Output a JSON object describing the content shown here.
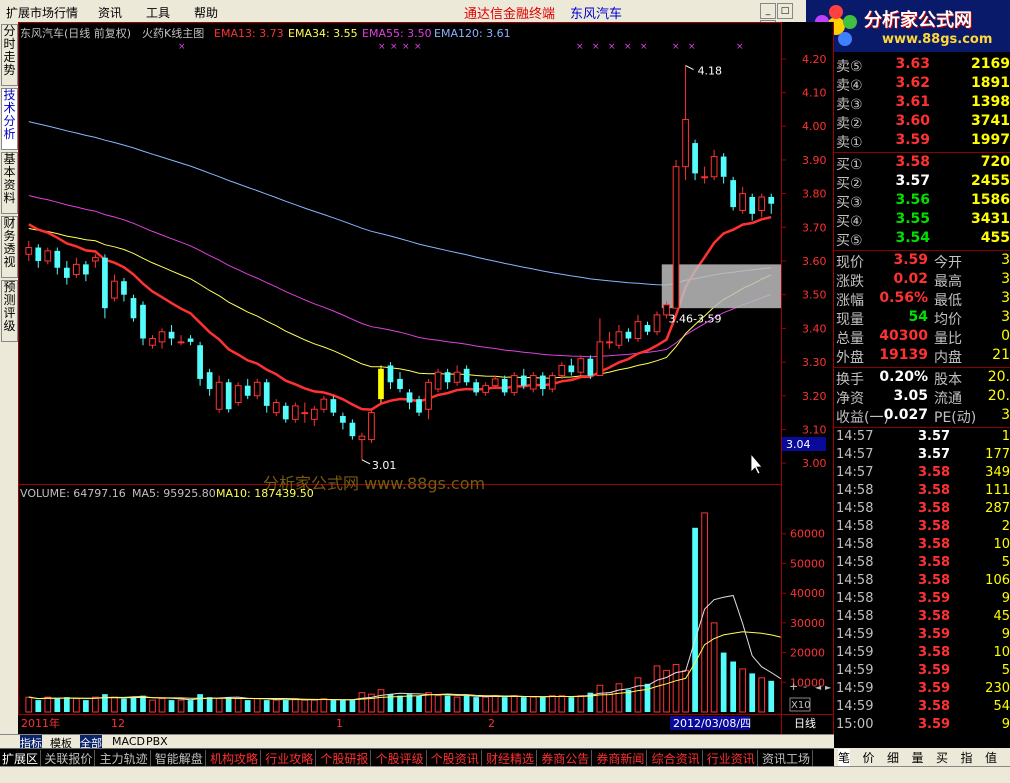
{
  "menubar": {
    "items": [
      "扩展市场行情",
      "资讯",
      "工具",
      "帮助"
    ],
    "ad1": "通达信金融终端",
    "ad2": "东风汽车"
  },
  "logo": {
    "title": "分析家公式网",
    "url": "www.88gs.com"
  },
  "left_tabs": [
    "分时走势",
    "技术分析",
    "基本资料",
    "财务透视",
    "预测评级"
  ],
  "chart_header": {
    "stock": "东风汽车(日线 前复权)",
    "formula": "火药K线主图",
    "ema13": "EMA13: 3.73",
    "ema34": "EMA34: 3.55",
    "ema55": "EMA55: 3.50",
    "ema120": "EMA120: 3.61"
  },
  "colors": {
    "up": "#ff3232",
    "down": "#54fcfc",
    "ema13": "#ff3232",
    "ema34": "#ffff54",
    "ema55": "#e040e0",
    "ema120": "#8ab4ff",
    "highlight": "#ffff00"
  },
  "price_axis": {
    "ticks": [
      "4.20",
      "4.10",
      "4.00",
      "3.90",
      "3.80",
      "3.70",
      "3.60",
      "3.50",
      "3.40",
      "3.30",
      "3.20",
      "3.10",
      "3.00"
    ],
    "min": 2.95,
    "max": 4.25,
    "current_label": "3.04"
  },
  "annotations": {
    "high": "4.18",
    "low": "3.01",
    "range": "3.46-3.59"
  },
  "watermark": "分析家公式网  www.88gs.com",
  "volume_header": {
    "volume": "VOLUME: 64797.16",
    "ma5": "MA5: 95925.80",
    "ma10": "MA10: 187439.50"
  },
  "volume_axis": {
    "ticks": [
      "60000",
      "50000",
      "40000",
      "30000",
      "20000",
      "10000"
    ],
    "max": 70000,
    "unit": "X10"
  },
  "date_axis": {
    "labels": [
      "2011年",
      "12",
      "1",
      "2"
    ],
    "cursor_date": "2012/03/08/四",
    "period": "日线"
  },
  "chart_data": {
    "type": "candlestick",
    "candles": [
      {
        "o": 3.62,
        "c": 3.64,
        "h": 3.66,
        "l": 3.6
      },
      {
        "o": 3.64,
        "c": 3.6,
        "h": 3.65,
        "l": 3.58
      },
      {
        "o": 3.6,
        "c": 3.63,
        "h": 3.64,
        "l": 3.59
      },
      {
        "o": 3.63,
        "c": 3.58,
        "h": 3.64,
        "l": 3.56
      },
      {
        "o": 3.58,
        "c": 3.55,
        "h": 3.6,
        "l": 3.53
      },
      {
        "o": 3.56,
        "c": 3.59,
        "h": 3.61,
        "l": 3.55
      },
      {
        "o": 3.59,
        "c": 3.56,
        "h": 3.6,
        "l": 3.54
      },
      {
        "o": 3.6,
        "c": 3.61,
        "h": 3.62,
        "l": 3.58
      },
      {
        "o": 3.61,
        "c": 3.46,
        "h": 3.62,
        "l": 3.43
      },
      {
        "o": 3.49,
        "c": 3.54,
        "h": 3.56,
        "l": 3.48
      },
      {
        "o": 3.54,
        "c": 3.5,
        "h": 3.55,
        "l": 3.48
      },
      {
        "o": 3.49,
        "c": 3.43,
        "h": 3.5,
        "l": 3.42
      },
      {
        "o": 3.47,
        "c": 3.37,
        "h": 3.48,
        "l": 3.35
      },
      {
        "o": 3.35,
        "c": 3.37,
        "h": 3.38,
        "l": 3.34
      },
      {
        "o": 3.36,
        "c": 3.39,
        "h": 3.4,
        "l": 3.34
      },
      {
        "o": 3.39,
        "c": 3.37,
        "h": 3.41,
        "l": 3.35
      },
      {
        "o": 3.36,
        "c": 3.36,
        "h": 3.38,
        "l": 3.35
      },
      {
        "o": 3.37,
        "c": 3.36,
        "h": 3.38,
        "l": 3.35
      },
      {
        "o": 3.35,
        "c": 3.25,
        "h": 3.36,
        "l": 3.23
      },
      {
        "o": 3.27,
        "c": 3.22,
        "h": 3.28,
        "l": 3.2
      },
      {
        "o": 3.16,
        "c": 3.24,
        "h": 3.26,
        "l": 3.15
      },
      {
        "o": 3.24,
        "c": 3.16,
        "h": 3.25,
        "l": 3.15
      },
      {
        "o": 3.18,
        "c": 3.23,
        "h": 3.24,
        "l": 3.17
      },
      {
        "o": 3.23,
        "c": 3.2,
        "h": 3.25,
        "l": 3.19
      },
      {
        "o": 3.2,
        "c": 3.24,
        "h": 3.25,
        "l": 3.19
      },
      {
        "o": 3.24,
        "c": 3.17,
        "h": 3.25,
        "l": 3.15
      },
      {
        "o": 3.15,
        "c": 3.18,
        "h": 3.19,
        "l": 3.14
      },
      {
        "o": 3.17,
        "c": 3.13,
        "h": 3.18,
        "l": 3.12
      },
      {
        "o": 3.13,
        "c": 3.17,
        "h": 3.18,
        "l": 3.12
      },
      {
        "o": 3.15,
        "c": 3.15,
        "h": 3.18,
        "l": 3.12
      },
      {
        "o": 3.13,
        "c": 3.16,
        "h": 3.17,
        "l": 3.11
      },
      {
        "o": 3.16,
        "c": 3.19,
        "h": 3.2,
        "l": 3.15
      },
      {
        "o": 3.19,
        "c": 3.15,
        "h": 3.2,
        "l": 3.14
      },
      {
        "o": 3.14,
        "c": 3.12,
        "h": 3.15,
        "l": 3.1
      },
      {
        "o": 3.12,
        "c": 3.08,
        "h": 3.13,
        "l": 3.07
      },
      {
        "o": 3.07,
        "c": 3.08,
        "h": 3.09,
        "l": 3.01
      },
      {
        "o": 3.07,
        "c": 3.15,
        "h": 3.16,
        "l": 3.06
      },
      {
        "o": 3.19,
        "c": 3.28,
        "h": 3.29,
        "l": 3.18
      },
      {
        "o": 3.29,
        "c": 3.24,
        "h": 3.3,
        "l": 3.22
      },
      {
        "o": 3.25,
        "c": 3.22,
        "h": 3.27,
        "l": 3.21
      },
      {
        "o": 3.21,
        "c": 3.18,
        "h": 3.22,
        "l": 3.16
      },
      {
        "o": 3.19,
        "c": 3.15,
        "h": 3.2,
        "l": 3.14
      },
      {
        "o": 3.16,
        "c": 3.24,
        "h": 3.25,
        "l": 3.13
      },
      {
        "o": 3.22,
        "c": 3.27,
        "h": 3.28,
        "l": 3.21
      },
      {
        "o": 3.27,
        "c": 3.24,
        "h": 3.28,
        "l": 3.22
      },
      {
        "o": 3.24,
        "c": 3.27,
        "h": 3.29,
        "l": 3.23
      },
      {
        "o": 3.28,
        "c": 3.24,
        "h": 3.29,
        "l": 3.23
      },
      {
        "o": 3.24,
        "c": 3.21,
        "h": 3.25,
        "l": 3.2
      },
      {
        "o": 3.21,
        "c": 3.23,
        "h": 3.24,
        "l": 3.2
      },
      {
        "o": 3.23,
        "c": 3.25,
        "h": 3.26,
        "l": 3.22
      },
      {
        "o": 3.25,
        "c": 3.21,
        "h": 3.26,
        "l": 3.2
      },
      {
        "o": 3.21,
        "c": 3.26,
        "h": 3.27,
        "l": 3.2
      },
      {
        "o": 3.26,
        "c": 3.23,
        "h": 3.28,
        "l": 3.22
      },
      {
        "o": 3.22,
        "c": 3.26,
        "h": 3.27,
        "l": 3.21
      },
      {
        "o": 3.26,
        "c": 3.22,
        "h": 3.27,
        "l": 3.2
      },
      {
        "o": 3.22,
        "c": 3.26,
        "h": 3.27,
        "l": 3.21
      },
      {
        "o": 3.26,
        "c": 3.29,
        "h": 3.3,
        "l": 3.25
      },
      {
        "o": 3.29,
        "c": 3.27,
        "h": 3.31,
        "l": 3.26
      },
      {
        "o": 3.27,
        "c": 3.31,
        "h": 3.32,
        "l": 3.26
      },
      {
        "o": 3.31,
        "c": 3.26,
        "h": 3.32,
        "l": 3.25
      },
      {
        "o": 3.26,
        "c": 3.36,
        "h": 3.43,
        "l": 3.26
      },
      {
        "o": 3.36,
        "c": 3.36,
        "h": 3.39,
        "l": 3.34
      },
      {
        "o": 3.35,
        "c": 3.39,
        "h": 3.41,
        "l": 3.34
      },
      {
        "o": 3.39,
        "c": 3.37,
        "h": 3.4,
        "l": 3.36
      },
      {
        "o": 3.37,
        "c": 3.42,
        "h": 3.44,
        "l": 3.36
      },
      {
        "o": 3.41,
        "c": 3.39,
        "h": 3.42,
        "l": 3.38
      },
      {
        "o": 3.39,
        "c": 3.44,
        "h": 3.45,
        "l": 3.38
      },
      {
        "o": 3.44,
        "c": 3.47,
        "h": 3.48,
        "l": 3.43
      },
      {
        "o": 3.46,
        "c": 3.88,
        "h": 3.9,
        "l": 3.46
      },
      {
        "o": 3.88,
        "c": 4.02,
        "h": 4.18,
        "l": 3.84
      },
      {
        "o": 3.95,
        "c": 3.86,
        "h": 3.96,
        "l": 3.84
      },
      {
        "o": 3.85,
        "c": 3.85,
        "h": 3.88,
        "l": 3.83
      },
      {
        "o": 3.85,
        "c": 3.91,
        "h": 3.93,
        "l": 3.84
      },
      {
        "o": 3.91,
        "c": 3.85,
        "h": 3.92,
        "l": 3.83
      },
      {
        "o": 3.84,
        "c": 3.76,
        "h": 3.85,
        "l": 3.75
      },
      {
        "o": 3.75,
        "c": 3.8,
        "h": 3.82,
        "l": 3.74
      },
      {
        "o": 3.79,
        "c": 3.74,
        "h": 3.8,
        "l": 3.72
      },
      {
        "o": 3.75,
        "c": 3.79,
        "h": 3.8,
        "l": 3.73
      },
      {
        "o": 3.79,
        "c": 3.77,
        "h": 3.8,
        "l": 3.74
      }
    ],
    "volume_scale": [
      3,
      3,
      3,
      3,
      3,
      3,
      3,
      3,
      3.5,
      3,
      3,
      3,
      3,
      3,
      3,
      3,
      3,
      3,
      3.5,
      3,
      3,
      3,
      3,
      3,
      3,
      3,
      3,
      3,
      3,
      3,
      3,
      3,
      3,
      3,
      3,
      3.5,
      3.5,
      4.5,
      3.5,
      3.5,
      3.5,
      3.5,
      4,
      3.5,
      3.5,
      3.5,
      3.5,
      3.5,
      3.5,
      3.5,
      3.5,
      3.5,
      3.5,
      3.5,
      3.5,
      3.5,
      3.5,
      3.5,
      3.5,
      4,
      5,
      4,
      5.5,
      5,
      7,
      6.5,
      9,
      9,
      10,
      9.5,
      62,
      64,
      30,
      20,
      17,
      15,
      13,
      12,
      11,
      9
    ],
    "volume_real": [
      5000,
      4000,
      5000,
      4500,
      5000,
      4500,
      4000,
      5000,
      6000,
      5000,
      4500,
      5000,
      5500,
      4000,
      4500,
      4000,
      4000,
      4000,
      6000,
      5000,
      4500,
      5000,
      4500,
      4000,
      4500,
      4000,
      4000,
      4000,
      4500,
      4000,
      4000,
      4500,
      4000,
      4000,
      4000,
      6500,
      6000,
      7500,
      6000,
      5500,
      6000,
      5500,
      6500,
      5500,
      5500,
      5000,
      5500,
      5000,
      5000,
      5500,
      5000,
      5500,
      5000,
      5000,
      5000,
      5500,
      5500,
      5000,
      5500,
      6500,
      9000,
      6500,
      9500,
      7500,
      11500,
      9500,
      15500,
      14000,
      16000,
      14000,
      62000,
      67000,
      30000,
      20000,
      17000,
      14500,
      13000,
      11500,
      10500,
      6500
    ]
  },
  "order_book": {
    "sell": [
      {
        "label": "卖⑤",
        "price": "3.63",
        "vol": "2169"
      },
      {
        "label": "卖④",
        "price": "3.62",
        "vol": "1891"
      },
      {
        "label": "卖③",
        "price": "3.61",
        "vol": "1398"
      },
      {
        "label": "卖②",
        "price": "3.60",
        "vol": "3741"
      },
      {
        "label": "卖①",
        "price": "3.59",
        "vol": "1997"
      }
    ],
    "buy": [
      {
        "label": "买①",
        "price": "3.58",
        "vol": "720"
      },
      {
        "label": "买②",
        "price": "3.57",
        "vol": "2455"
      },
      {
        "label": "买③",
        "price": "3.56",
        "vol": "1586"
      },
      {
        "label": "买④",
        "price": "3.55",
        "vol": "3431"
      },
      {
        "label": "买⑤",
        "price": "3.54",
        "vol": "455"
      }
    ]
  },
  "stats": [
    {
      "l1": "现价",
      "v1": "3.59",
      "l2": "今开",
      "v2": "3"
    },
    {
      "l1": "涨跌",
      "v1": "0.02",
      "l2": "最高",
      "v2": "3"
    },
    {
      "l1": "涨幅",
      "v1": "0.56%",
      "l2": "最低",
      "v2": "3"
    },
    {
      "l1": "现量",
      "v1": "54",
      "l2": "均价",
      "v2": "3"
    },
    {
      "l1": "总量",
      "v1": "40300",
      "l2": "量比",
      "v2": "0"
    },
    {
      "l1": "外盘",
      "v1": "19139",
      "l2": "内盘",
      "v2": "21"
    },
    {
      "l1": "换手",
      "v1": "0.20%",
      "l2": "股本",
      "v2": "20."
    },
    {
      "l1": "净资",
      "v1": "3.05",
      "l2": "流通",
      "v2": "20."
    },
    {
      "l1": "收益(一)",
      "v1": "0.027",
      "l2": "PE(动)",
      "v2": "3"
    }
  ],
  "ticks": [
    {
      "t": "14:57",
      "p": "3.57",
      "v": "1"
    },
    {
      "t": "14:57",
      "p": "3.57",
      "v": "177"
    },
    {
      "t": "14:57",
      "p": "3.58",
      "v": "349"
    },
    {
      "t": "14:58",
      "p": "3.58",
      "v": "111"
    },
    {
      "t": "14:58",
      "p": "3.58",
      "v": "287"
    },
    {
      "t": "14:58",
      "p": "3.58",
      "v": "2"
    },
    {
      "t": "14:58",
      "p": "3.58",
      "v": "10"
    },
    {
      "t": "14:58",
      "p": "3.58",
      "v": "5"
    },
    {
      "t": "14:58",
      "p": "3.58",
      "v": "106"
    },
    {
      "t": "14:58",
      "p": "3.59",
      "v": "9"
    },
    {
      "t": "14:58",
      "p": "3.58",
      "v": "45"
    },
    {
      "t": "14:59",
      "p": "3.59",
      "v": "9"
    },
    {
      "t": "14:59",
      "p": "3.58",
      "v": "10"
    },
    {
      "t": "14:59",
      "p": "3.59",
      "v": "5"
    },
    {
      "t": "14:59",
      "p": "3.59",
      "v": "230"
    },
    {
      "t": "14:59",
      "p": "3.58",
      "v": "54"
    },
    {
      "t": "15:00",
      "p": "3.59",
      "v": "9"
    }
  ],
  "tabbar1": [
    "指标",
    "模板",
    "全部",
    "MACD",
    "PBX"
  ],
  "tabbar2": [
    "扩展区",
    "关联报价",
    "主力轨迹",
    "智能解盘",
    "机构攻略",
    "行业攻略",
    "个股研报",
    "个股评级",
    "个股资讯",
    "财经精选",
    "券商公告",
    "券商新闻",
    "综合资讯",
    "行业资讯",
    "资讯工场"
  ],
  "right_tabs": [
    "笔",
    "价",
    "细",
    "量",
    "买",
    "指",
    "值"
  ],
  "bottom_right": {
    "zoom_plus": "+",
    "zoom_minus": "-",
    "arrow_l": "◄",
    "arrow_r": "►"
  }
}
